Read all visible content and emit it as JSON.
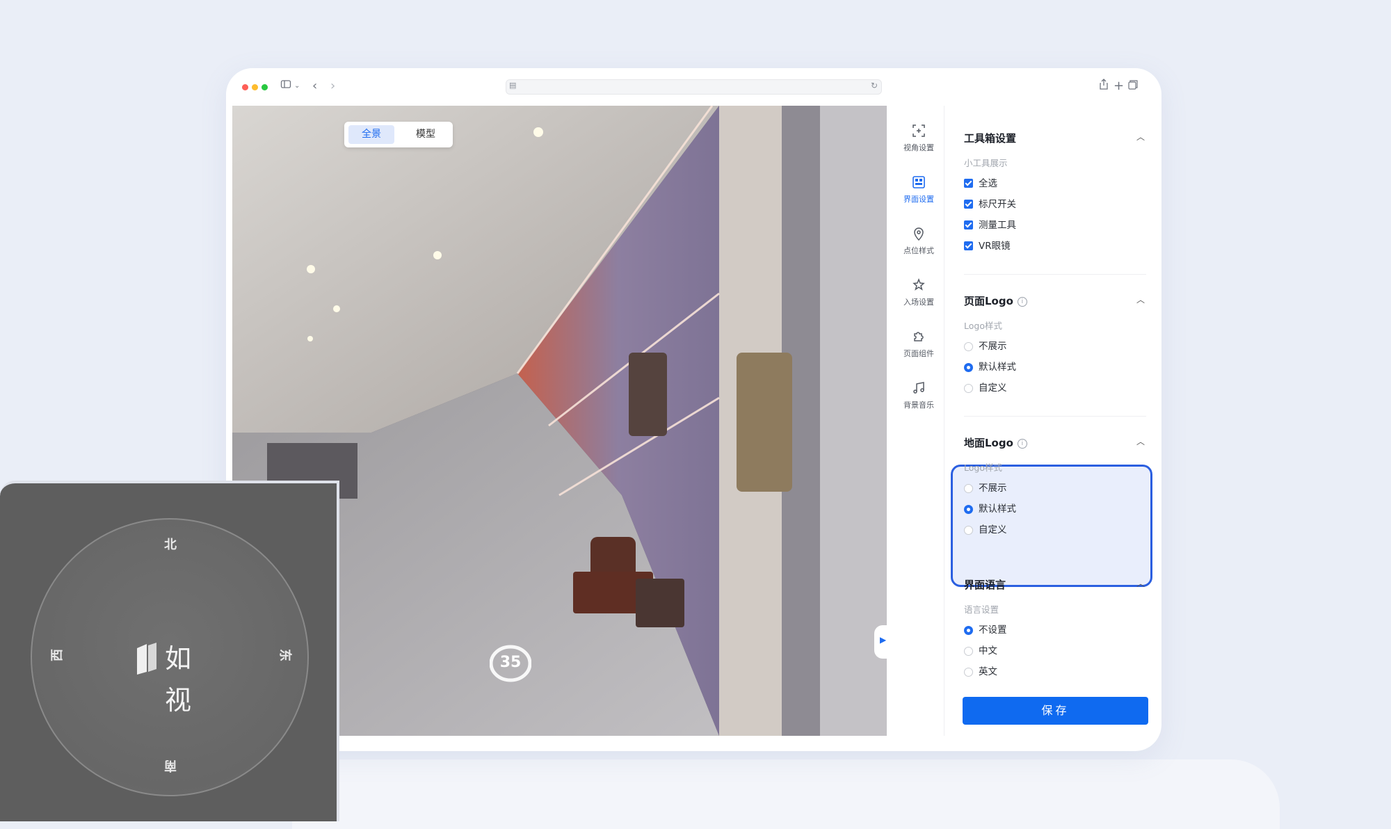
{
  "viewer": {
    "toggle": {
      "panorama": "全景",
      "model": "模型"
    },
    "point_number": "35"
  },
  "iconnav": {
    "items": [
      {
        "label": "视角设置",
        "icon": "view-angle-icon",
        "active": false
      },
      {
        "label": "界面设置",
        "icon": "ui-settings-icon",
        "active": true
      },
      {
        "label": "点位样式",
        "icon": "location-pin-icon",
        "active": false
      },
      {
        "label": "入场设置",
        "icon": "entry-star-icon",
        "active": false
      },
      {
        "label": "页面组件",
        "icon": "puzzle-icon",
        "active": false
      },
      {
        "label": "背景音乐",
        "icon": "music-note-icon",
        "active": false
      }
    ]
  },
  "panel": {
    "toolbox": {
      "title": "工具箱设置",
      "sublabel": "小工具展示",
      "options": [
        "全选",
        "标尺开关",
        "测量工具",
        "VR眼镜"
      ]
    },
    "page_logo": {
      "title": "页面Logo",
      "sublabel": "Logo样式",
      "options": [
        "不展示",
        "默认样式",
        "自定义"
      ],
      "selected": "默认样式"
    },
    "ground_logo": {
      "title": "地面Logo",
      "sublabel": "Logo样式",
      "options": [
        "不展示",
        "默认样式",
        "自定义"
      ],
      "selected": "默认样式"
    },
    "ui_language": {
      "title": "界面语言",
      "sublabel": "语言设置",
      "options": [
        "不设置",
        "中文",
        "英文"
      ],
      "selected": "不设置"
    },
    "save_label": "保存"
  },
  "compass": {
    "north": "北",
    "south": "南",
    "east": "东",
    "west": "西",
    "brand": "如视"
  },
  "colors": {
    "accent": "#1f6cf0",
    "highlight_border": "#2b5fe0"
  }
}
